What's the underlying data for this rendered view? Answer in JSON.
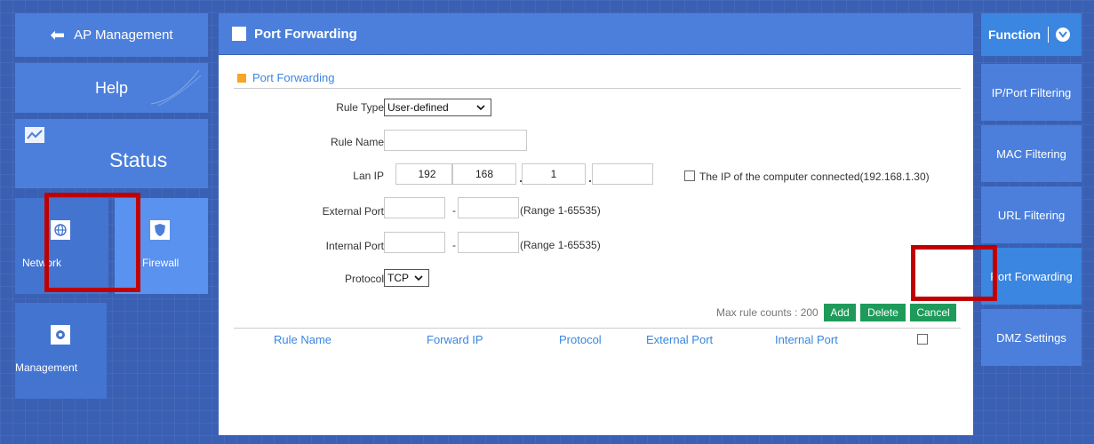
{
  "left_nav": {
    "ap_management": "AP Management",
    "help": "Help",
    "status": "Status",
    "network": "Network",
    "firewall": "Firewall",
    "management": "Management"
  },
  "header": {
    "title": "Port Forwarding"
  },
  "section": {
    "title": "Port Forwarding"
  },
  "form": {
    "rule_type_label": "Rule Type",
    "rule_type_value": "User-defined",
    "rule_name_label": "Rule Name",
    "rule_name_value": "",
    "lan_ip_label": "Lan IP",
    "lan_ip": [
      "192",
      "168",
      "1",
      ""
    ],
    "connected_ip_label": "The IP of the computer connected(192.168.1.30)",
    "external_port_label": "External Port",
    "internal_port_label": "Internal Port",
    "range_text": "(Range 1-65535)",
    "protocol_label": "Protocol",
    "protocol_value": "TCP"
  },
  "actions": {
    "max_rule_text": "Max rule counts : 200",
    "add": "Add",
    "delete": "Delete",
    "cancel": "Cancel"
  },
  "table": {
    "columns": [
      "Rule Name",
      "Forward IP",
      "Protocol",
      "External Port",
      "Internal Port"
    ]
  },
  "right_nav": {
    "function": "Function",
    "items": [
      "IP/Port Filtering",
      "MAC Filtering",
      "URL Filtering",
      "Port Forwarding",
      "DMZ Settings"
    ]
  },
  "colors": {
    "background": "#3a60b4",
    "tile": "#4b7fdb",
    "accent": "#3a86e0",
    "button_green": "#1e9b5a",
    "highlight_red": "#c00000"
  }
}
